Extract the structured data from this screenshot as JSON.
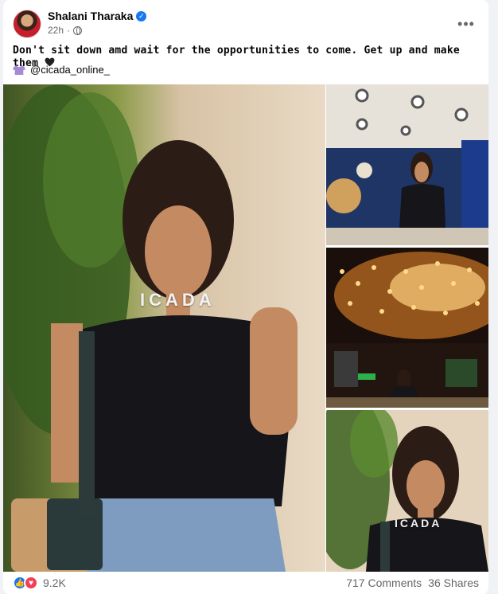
{
  "post": {
    "author": "Shalani Tharaka",
    "time": "22h",
    "dot": "·",
    "more": "•••",
    "caption": "Don't sit down amd wait for the opportunities to come. Get up and make them",
    "tag": "@cicada_online_"
  },
  "photos": {
    "shirt_text": "ICADA"
  },
  "footer": {
    "reactions": "9.2K",
    "comments": "717 Comments",
    "shares": "36 Shares"
  },
  "colors": {
    "accent": "#1877f2",
    "love": "#f33e58",
    "secondary_text": "#65676b"
  }
}
